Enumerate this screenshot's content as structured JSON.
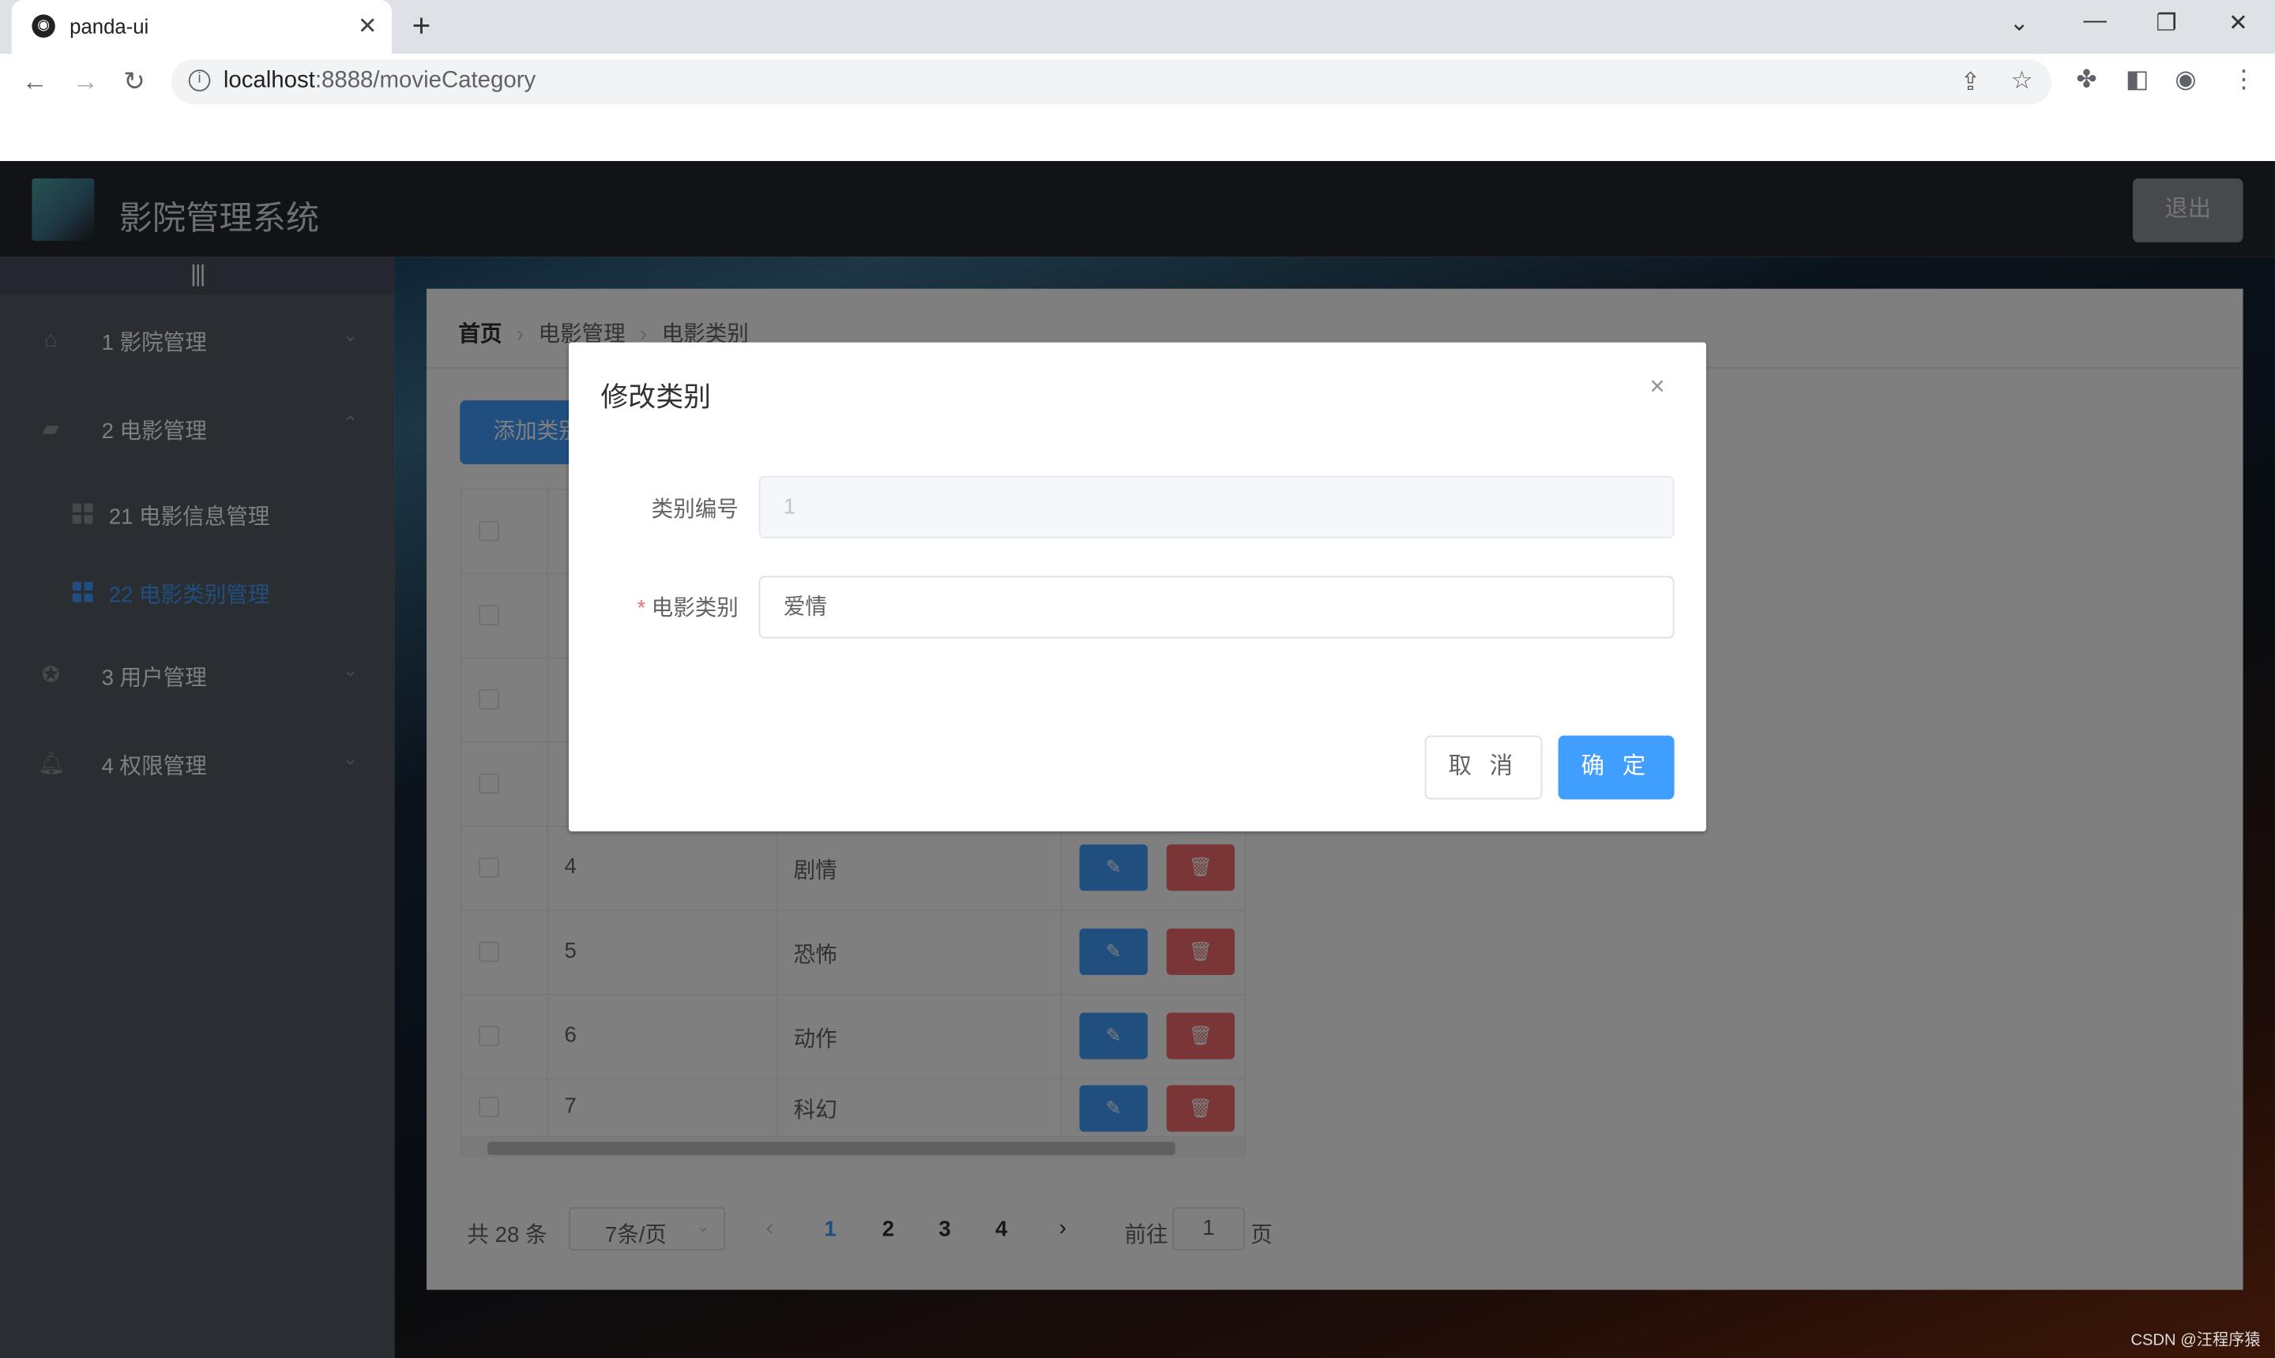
{
  "browser": {
    "tab_title": "panda-ui",
    "url_host": "localhost",
    "url_rest": ":8888/movieCategory"
  },
  "header": {
    "brand": "影院管理系统",
    "logout": "退出"
  },
  "sidebar": {
    "collapse": "|||",
    "items": [
      {
        "label": "1 影院管理",
        "icon": "home-icon",
        "arrow": "⌄"
      },
      {
        "label": "2 电影管理",
        "icon": "camera-icon",
        "arrow": "⌃"
      },
      {
        "label": "3 用户管理",
        "icon": "settings-icon",
        "arrow": "⌄"
      },
      {
        "label": "4 权限管理",
        "icon": "bell-icon",
        "arrow": "⌄"
      }
    ],
    "sub_items": [
      {
        "label": "21 电影信息管理"
      },
      {
        "label": "22 电影类别管理",
        "active": true
      }
    ]
  },
  "breadcrumb": {
    "home": "首页",
    "level1": "电影管理",
    "level2": "电影类别",
    "sep": "›"
  },
  "toolbar": {
    "add_label": "添加类别"
  },
  "table": {
    "rows": [
      {
        "id": "4",
        "name": "剧情"
      },
      {
        "id": "5",
        "name": "恐怖"
      },
      {
        "id": "6",
        "name": "动作"
      },
      {
        "id": "7",
        "name": "科幻"
      }
    ],
    "edit_glyph": "✎",
    "delete_glyph": "🗑"
  },
  "pagination": {
    "total": "共 28 条",
    "page_size": "7条/页",
    "pages": [
      "1",
      "2",
      "3",
      "4"
    ],
    "current": "1",
    "goto_label": "前往",
    "goto_value": "1",
    "goto_unit": "页"
  },
  "dialog": {
    "title": "修改类别",
    "close": "×",
    "id_label": "类别编号",
    "id_value": "1",
    "name_label": "电影类别",
    "name_value": "爱情",
    "cancel": "取 消",
    "confirm": "确 定"
  },
  "watermark": "CSDN @汪程序猿",
  "colors": {
    "primary": "#409eff",
    "danger": "#f56c6c",
    "sidebar": "#545c64",
    "header": "#23262e"
  }
}
